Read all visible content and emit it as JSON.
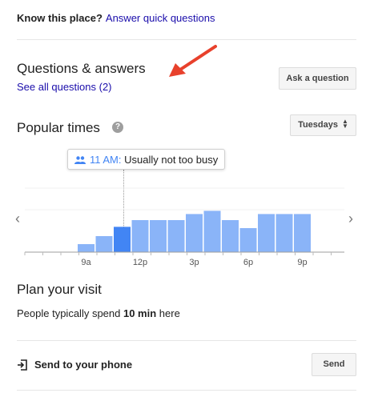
{
  "know_place": {
    "prompt": "Know this place?",
    "link": "Answer quick questions"
  },
  "qa": {
    "title": "Questions & answers",
    "see_all": "See all questions (2)",
    "ask_button": "Ask a question"
  },
  "popular_times": {
    "title": "Popular times",
    "help_glyph": "?",
    "day_selector": "Tuesdays",
    "tooltip": {
      "time": "11 AM:",
      "status": "Usually not too busy"
    },
    "nav_prev": "‹",
    "nav_next": "›"
  },
  "chart_data": {
    "type": "bar",
    "x_tick_labels": [
      "9a",
      "12p",
      "3p",
      "6p",
      "9p"
    ],
    "hours": [
      "9a",
      "10a",
      "11a",
      "12p",
      "1p",
      "2p",
      "3p",
      "4p",
      "5p",
      "6p",
      "7p",
      "8p",
      "9p"
    ],
    "values": [
      0.25,
      0.5,
      0.79,
      1.0,
      1.0,
      1.0,
      1.19,
      1.29,
      1.0,
      0.75,
      1.19,
      1.19,
      1.19
    ],
    "highlighted": "11a",
    "colors": {
      "bar": "#8ab4f8",
      "highlight": "#4285f4"
    },
    "grid": true,
    "ylim": [
      0,
      1.5
    ]
  },
  "plan": {
    "title": "Plan your visit",
    "text_prefix": "People typically spend",
    "duration": "10 min",
    "text_suffix": "here"
  },
  "send": {
    "label": "Send to your phone",
    "button": "Send"
  },
  "colors": {
    "link": "#1a0dab",
    "accent": "#4285f4",
    "arrow": "#e8412c"
  },
  "icons": [
    "annotation-arrow-icon",
    "help-icon",
    "people-icon",
    "chevron-left-icon",
    "chevron-right-icon",
    "send-to-phone-icon"
  ]
}
